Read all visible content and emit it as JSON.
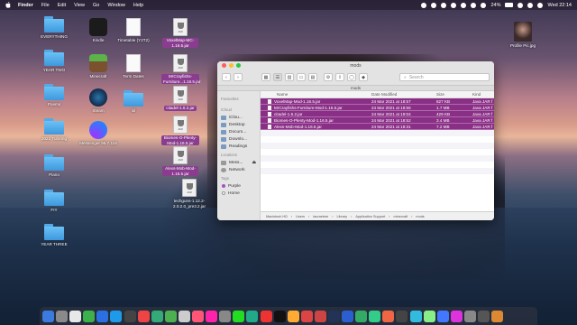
{
  "menubar": {
    "app": "Finder",
    "items": [
      "File",
      "Edit",
      "View",
      "Go",
      "Window",
      "Help"
    ],
    "battery": "24%",
    "clock": "Wed 22:14"
  },
  "desktop_left": [
    {
      "label": "EVERYTHING"
    },
    {
      "label": "YEAR TWO"
    },
    {
      "label": "Poems"
    },
    {
      "label": "2021 Tutoring"
    },
    {
      "label": "Piano"
    },
    {
      "label": "FIY"
    },
    {
      "label": "YEAR THREE"
    }
  ],
  "desktop_apps": [
    {
      "label": "Kindle"
    },
    {
      "label": "Minecraft"
    },
    {
      "label": "Steam"
    },
    {
      "label": "Messenger 95.7.118"
    }
  ],
  "desktop_docs": [
    {
      "label": "Timetable (Y2T2)"
    },
    {
      "label": "Term Dates"
    },
    {
      "label": "lol"
    }
  ],
  "desktop_jars": [
    {
      "label": "VoxelMap-MC-1.16.5.jar",
      "selected": true
    },
    {
      "label": "MrCrayfishs-Furniture...1.16.5.jar",
      "selected": true
    },
    {
      "label": "citadel-1.6.2.jar",
      "selected": true
    },
    {
      "label": "Biomes-O-Plenty-Mod-1.16.5.jar",
      "selected": true
    },
    {
      "label": "Alexs-Mob-Mod-1.16.5.jar",
      "selected": true
    },
    {
      "label": "techguns-1.12.2-2.0.2.0_pre3.2.jar",
      "selected": false
    }
  ],
  "profile_pic": {
    "label": "Profile Pic.jpg"
  },
  "finder": {
    "title": "mods",
    "path_title": "mods",
    "search_placeholder": "Search",
    "sidebar": {
      "favourites_header": "Favourites",
      "icloud_header": "iCloud",
      "icloud_items": [
        "iClou...",
        "Desktop",
        "Docum...",
        "Downlo...",
        "Readings"
      ],
      "locations_header": "Locations",
      "locations_items": [
        "Mess...",
        "Network"
      ],
      "tags_header": "Tags",
      "tags_items": [
        "Purple",
        "Home"
      ]
    },
    "columns": {
      "name": "Name",
      "date": "Date Modified",
      "size": "Size",
      "kind": "Kind"
    },
    "files": [
      {
        "name": "VoxelMap-Mod-1.16.5.jar",
        "date": "24 Mar 2021 at 18:57",
        "size": "827 KB",
        "kind": "Java JAR f"
      },
      {
        "name": "MrCrayfishs-Furniture-Mod-1.16.5.jar",
        "date": "24 Mar 2021 at 18:56",
        "size": "1.7 MB",
        "kind": "Java JAR f"
      },
      {
        "name": "citadel-1.6.2.jar",
        "date": "24 Mar 2021 at 19:04",
        "size": "429 KB",
        "kind": "Java JAR f"
      },
      {
        "name": "Biomes-O-Plenty-Mod-1.16.5.jar",
        "date": "24 Mar 2021 at 18:52",
        "size": "3.4 MB",
        "kind": "Java JAR f"
      },
      {
        "name": "Alexs-Mob-Mod-1.16.5.jar",
        "date": "24 Mar 2021 at 18:31",
        "size": "7.2 MB",
        "kind": "Java JAR f"
      }
    ],
    "pathbar": [
      "Macintosh HD",
      "Users",
      "lauraetme",
      "Library",
      "Application Support",
      "minecraft",
      "mods"
    ]
  },
  "dock_colors": [
    "#3b7be0",
    "#8a8a8a",
    "#e8e8e8",
    "#3cb04a",
    "#2b6fe3",
    "#1f9ae8",
    "#444",
    "#e44",
    "#3a7",
    "#4caf50",
    "#ccc",
    "#f57",
    "#f2a",
    "#888",
    "#2d2",
    "#2a8",
    "#e33",
    "#111",
    "#fa3",
    "#d44",
    "#c44",
    "#235",
    "#2b5fcf",
    "#3a6",
    "#3c8",
    "#e64",
    "#444",
    "#3bd",
    "#8e8",
    "#47f",
    "#d3d",
    "#888",
    "#555",
    "#d83"
  ]
}
